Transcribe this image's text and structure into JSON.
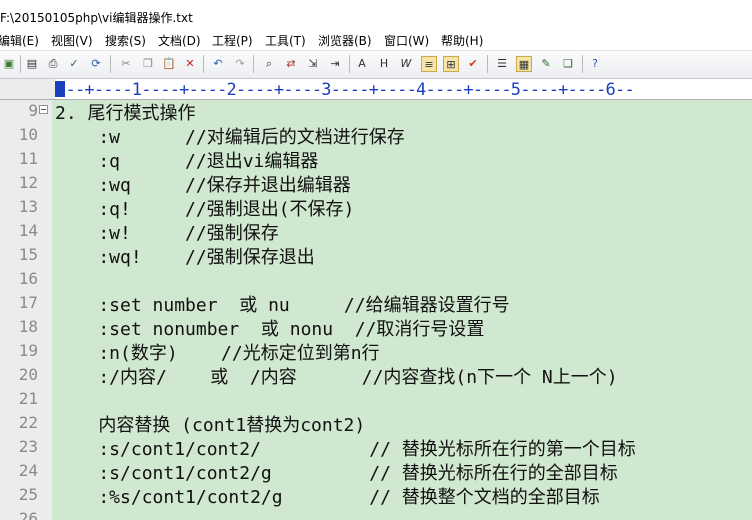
{
  "window": {
    "title": "F:\\20150105php\\vi编辑器操作.txt"
  },
  "menu": [
    "编辑(E)",
    "视图(V)",
    "搜索(S)",
    "文档(D)",
    "工程(P)",
    "工具(T)",
    "浏览器(B)",
    "窗口(W)",
    "帮助(H)"
  ],
  "toolbar": {
    "icons": [
      "new-file-icon",
      "print-preview-icon",
      "print-icon",
      "spell-check-icon",
      "refresh-icon",
      "cut-icon",
      "copy-icon",
      "paste-icon",
      "delete-icon",
      "undo-icon",
      "redo-icon",
      "find-icon",
      "replace-icon",
      "goto-icon",
      "indent-icon",
      "font-icon",
      "hex-icon",
      "word-wrap-icon",
      "toggle-icon",
      "column-mode-icon",
      "check-icon",
      "list-icon",
      "ruler-icon",
      "edit-icon",
      "window-icon",
      "help-icon"
    ]
  },
  "ruler": {
    "text": "---+----1----+----2----+----3----+----4----+----5----+----6--"
  },
  "editor": {
    "lines": [
      {
        "num": "9",
        "text": "2. 尾行模式操作",
        "fold": true
      },
      {
        "num": "10",
        "text": "    :w      //对编辑后的文档进行保存"
      },
      {
        "num": "11",
        "text": "    :q      //退出vi编辑器"
      },
      {
        "num": "12",
        "text": "    :wq     //保存并退出编辑器"
      },
      {
        "num": "13",
        "text": "    :q!     //强制退出(不保存)"
      },
      {
        "num": "14",
        "text": "    :w!     //强制保存"
      },
      {
        "num": "15",
        "text": "    :wq!    //强制保存退出"
      },
      {
        "num": "16",
        "text": ""
      },
      {
        "num": "17",
        "text": "    :set number  或 nu     //给编辑器设置行号"
      },
      {
        "num": "18",
        "text": "    :set nonumber  或 nonu  //取消行号设置"
      },
      {
        "num": "19",
        "text": "    :n(数字)    //光标定位到第n行"
      },
      {
        "num": "20",
        "text": "    :/内容/    或  /内容      //内容查找(n下一个 N上一个)"
      },
      {
        "num": "21",
        "text": ""
      },
      {
        "num": "22",
        "text": "    内容替换 (cont1替换为cont2)"
      },
      {
        "num": "23",
        "text": "    :s/cont1/cont2/          // 替换光标所在行的第一个目标"
      },
      {
        "num": "24",
        "text": "    :s/cont1/cont2/g         // 替换光标所在行的全部目标"
      },
      {
        "num": "25",
        "text": "    :%s/cont1/cont2/g        // 替换整个文档的全部目标"
      },
      {
        "num": "26",
        "text": ""
      }
    ]
  },
  "colors": {
    "editor_bg": "#cfe8cf",
    "ruler_text": "#1c3fbf",
    "line_numbers": "#8a8a8a",
    "gutter_bg": "#ececec"
  }
}
